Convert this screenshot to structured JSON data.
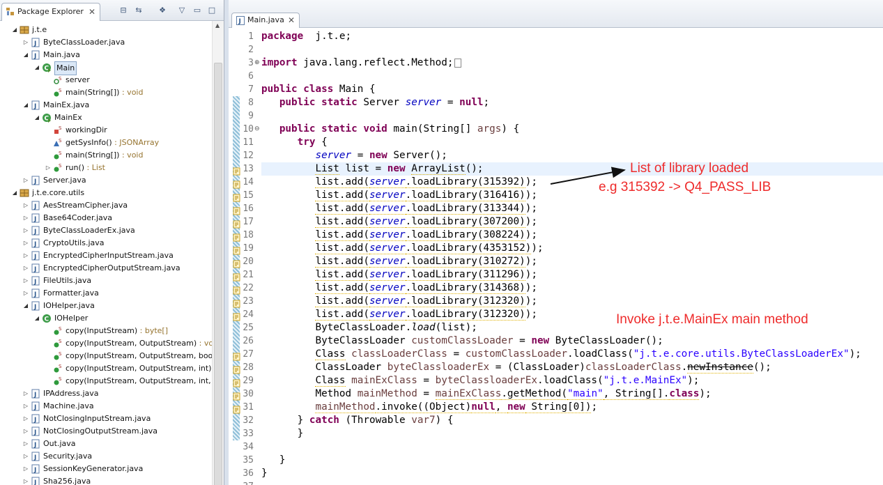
{
  "explorer": {
    "tab_label": "Package Explorer",
    "tree": [
      {
        "label": "j.t.e",
        "kind": "package",
        "level": 0,
        "twisty": "open"
      },
      {
        "label": "ByteClassLoader.java",
        "kind": "java",
        "level": 1,
        "twisty": "closed"
      },
      {
        "label": "Main.java",
        "kind": "java",
        "level": 1,
        "twisty": "open"
      },
      {
        "label": "Main",
        "kind": "class-main",
        "level": 2,
        "twisty": "open",
        "selected": true
      },
      {
        "label": "server",
        "kind": "field",
        "level": 3,
        "twisty": ""
      },
      {
        "label": "main(String[])",
        "suffix": " : void",
        "kind": "method",
        "level": 3,
        "twisty": ""
      },
      {
        "label": "MainEx.java",
        "kind": "java",
        "level": 1,
        "twisty": "open"
      },
      {
        "label": "MainEx",
        "kind": "class-main",
        "level": 2,
        "twisty": "open"
      },
      {
        "label": "workingDir",
        "kind": "field-private",
        "level": 3,
        "twisty": ""
      },
      {
        "label": "getSysInfo()",
        "suffix": " : JSONArray",
        "kind": "method-triangle",
        "level": 3,
        "twisty": ""
      },
      {
        "label": "main(String[])",
        "suffix": " : void",
        "kind": "method",
        "level": 3,
        "twisty": ""
      },
      {
        "label": "run()",
        "suffix": " : List",
        "kind": "method",
        "level": 3,
        "twisty": "closed"
      },
      {
        "label": "Server.java",
        "kind": "java",
        "level": 1,
        "twisty": "closed"
      },
      {
        "label": "j.t.e.core.utils",
        "kind": "package",
        "level": 0,
        "twisty": "open"
      },
      {
        "label": "AesStreamCipher.java",
        "kind": "java",
        "level": 1,
        "twisty": "closed"
      },
      {
        "label": "Base64Coder.java",
        "kind": "java",
        "level": 1,
        "twisty": "closed"
      },
      {
        "label": "ByteClassLoaderEx.java",
        "kind": "java",
        "level": 1,
        "twisty": "closed"
      },
      {
        "label": "CryptoUtils.java",
        "kind": "java",
        "level": 1,
        "twisty": "closed"
      },
      {
        "label": "EncryptedCipherInputStream.java",
        "kind": "java",
        "level": 1,
        "twisty": "closed"
      },
      {
        "label": "EncryptedCipherOutputStream.java",
        "kind": "java",
        "level": 1,
        "twisty": "closed"
      },
      {
        "label": "FileUtils.java",
        "kind": "java",
        "level": 1,
        "twisty": "closed"
      },
      {
        "label": "Formatter.java",
        "kind": "java",
        "level": 1,
        "twisty": "closed"
      },
      {
        "label": "IOHelper.java",
        "kind": "java",
        "level": 1,
        "twisty": "open"
      },
      {
        "label": "IOHelper",
        "kind": "class",
        "level": 2,
        "twisty": "open"
      },
      {
        "label": "copy(InputStream)",
        "suffix": " : byte[]",
        "kind": "method",
        "level": 3,
        "twisty": ""
      },
      {
        "label": "copy(InputStream, OutputStream)",
        "suffix": " : void",
        "kind": "method",
        "level": 3,
        "twisty": ""
      },
      {
        "label": "copy(InputStream, OutputStream, boole",
        "suffix": "",
        "kind": "method",
        "level": 3,
        "twisty": ""
      },
      {
        "label": "copy(InputStream, OutputStream, int)",
        "suffix": " :",
        "kind": "method",
        "level": 3,
        "twisty": ""
      },
      {
        "label": "copy(InputStream, OutputStream, int, b",
        "suffix": "",
        "kind": "method",
        "level": 3,
        "twisty": ""
      },
      {
        "label": "IPAddress.java",
        "kind": "java",
        "level": 1,
        "twisty": "closed"
      },
      {
        "label": "Machine.java",
        "kind": "java",
        "level": 1,
        "twisty": "closed"
      },
      {
        "label": "NotClosingInputStream.java",
        "kind": "java",
        "level": 1,
        "twisty": "closed"
      },
      {
        "label": "NotClosingOutputStream.java",
        "kind": "java",
        "level": 1,
        "twisty": "closed"
      },
      {
        "label": "Out.java",
        "kind": "java",
        "level": 1,
        "twisty": "closed"
      },
      {
        "label": "Security.java",
        "kind": "java",
        "level": 1,
        "twisty": "closed"
      },
      {
        "label": "SessionKeyGenerator.java",
        "kind": "java",
        "level": 1,
        "twisty": "closed"
      },
      {
        "label": "Sha256.java",
        "kind": "java",
        "level": 1,
        "twisty": "closed"
      }
    ]
  },
  "editor": {
    "tab_label": "Main.java",
    "lines": [
      {
        "n": "1",
        "segs": [
          [
            "kw",
            "package"
          ],
          [
            "",
            "  j.t.e;"
          ]
        ]
      },
      {
        "n": "2",
        "segs": []
      },
      {
        "n": "3",
        "fold": "+",
        "segs": [
          [
            "kw",
            "import"
          ],
          [
            "",
            " java.lang.reflect.Method;"
          ],
          [
            "foldbox",
            ""
          ]
        ]
      },
      {
        "n": "6",
        "segs": []
      },
      {
        "n": "7",
        "segs": [
          [
            "kw",
            "public"
          ],
          [
            "",
            " "
          ],
          [
            "kw",
            "class"
          ],
          [
            "",
            " Main {"
          ]
        ]
      },
      {
        "n": "8",
        "segs": [
          [
            "",
            "   "
          ],
          [
            "kw",
            "public"
          ],
          [
            "",
            " "
          ],
          [
            "kw",
            "static"
          ],
          [
            "",
            " Server "
          ],
          [
            "fld",
            "server"
          ],
          [
            "",
            " = "
          ],
          [
            "kw",
            "null"
          ],
          [
            ";"
          ]
        ]
      },
      {
        "n": "9",
        "segs": []
      },
      {
        "n": "10",
        "fold": "−",
        "segs": [
          [
            "",
            "   "
          ],
          [
            "kw",
            "public"
          ],
          [
            "",
            " "
          ],
          [
            "kw",
            "static"
          ],
          [
            "",
            " "
          ],
          [
            "kw",
            "void"
          ],
          [
            "",
            " main(String[] "
          ],
          [
            "gray",
            "args"
          ],
          [
            ") {"
          ]
        ]
      },
      {
        "n": "11",
        "segs": [
          [
            "",
            "      "
          ],
          [
            "kw",
            "try"
          ],
          [
            "",
            " {"
          ]
        ]
      },
      {
        "n": "12",
        "segs": [
          [
            "",
            "         "
          ],
          [
            "fld",
            "server"
          ],
          [
            "",
            " = "
          ],
          [
            "kw",
            "new"
          ],
          [
            "",
            " Server();"
          ]
        ]
      },
      {
        "n": "13",
        "warn": true,
        "current": true,
        "segs": [
          [
            "",
            "         "
          ],
          [
            "sq",
            "List"
          ],
          [
            "",
            " list = "
          ],
          [
            "kw",
            "new"
          ],
          [
            "",
            " "
          ],
          [
            "sq",
            "ArrayList"
          ],
          [
            "();"
          ]
        ]
      },
      {
        "n": "14",
        "warn": true,
        "segs": [
          [
            "",
            "         "
          ],
          [
            "sq",
            "list.add("
          ],
          [
            "fld sq",
            "server"
          ],
          [
            "sq",
            ".loadLibrary(315392)"
          ],
          [
            ");"
          ]
        ]
      },
      {
        "n": "15",
        "warn": true,
        "segs": [
          [
            "",
            "         "
          ],
          [
            "sq",
            "list.add("
          ],
          [
            "fld sq",
            "server"
          ],
          [
            "sq",
            ".loadLibrary(316416)"
          ],
          [
            ");"
          ]
        ]
      },
      {
        "n": "16",
        "warn": true,
        "segs": [
          [
            "",
            "         "
          ],
          [
            "sq",
            "list.add("
          ],
          [
            "fld sq",
            "server"
          ],
          [
            "sq",
            ".loadLibrary(313344)"
          ],
          [
            ");"
          ]
        ]
      },
      {
        "n": "17",
        "warn": true,
        "segs": [
          [
            "",
            "         "
          ],
          [
            "sq",
            "list.add("
          ],
          [
            "fld sq",
            "server"
          ],
          [
            "sq",
            ".loadLibrary(307200)"
          ],
          [
            ");"
          ]
        ]
      },
      {
        "n": "18",
        "warn": true,
        "segs": [
          [
            "",
            "         "
          ],
          [
            "sq",
            "list.add("
          ],
          [
            "fld sq",
            "server"
          ],
          [
            "sq",
            ".loadLibrary(308224)"
          ],
          [
            ");"
          ]
        ]
      },
      {
        "n": "19",
        "warn": true,
        "segs": [
          [
            "",
            "         "
          ],
          [
            "sq",
            "list.add("
          ],
          [
            "fld sq",
            "server"
          ],
          [
            "sq",
            ".loadLibrary(4353152)"
          ],
          [
            ");"
          ]
        ]
      },
      {
        "n": "20",
        "warn": true,
        "segs": [
          [
            "",
            "         "
          ],
          [
            "sq",
            "list.add("
          ],
          [
            "fld sq",
            "server"
          ],
          [
            "sq",
            ".loadLibrary(310272)"
          ],
          [
            ");"
          ]
        ]
      },
      {
        "n": "21",
        "warn": true,
        "segs": [
          [
            "",
            "         "
          ],
          [
            "sq",
            "list.add("
          ],
          [
            "fld sq",
            "server"
          ],
          [
            "sq",
            ".loadLibrary(311296)"
          ],
          [
            ");"
          ]
        ]
      },
      {
        "n": "22",
        "warn": true,
        "segs": [
          [
            "",
            "         "
          ],
          [
            "sq",
            "list.add("
          ],
          [
            "fld sq",
            "server"
          ],
          [
            "sq",
            ".loadLibrary(314368)"
          ],
          [
            ");"
          ]
        ]
      },
      {
        "n": "23",
        "warn": true,
        "segs": [
          [
            "",
            "         "
          ],
          [
            "sq",
            "list.add("
          ],
          [
            "fld sq",
            "server"
          ],
          [
            "sq",
            ".loadLibrary(312320)"
          ],
          [
            ");"
          ]
        ]
      },
      {
        "n": "24",
        "warn": true,
        "segs": [
          [
            "",
            "         "
          ],
          [
            "sq",
            "list.add("
          ],
          [
            "fld sq",
            "server"
          ],
          [
            "sq",
            ".loadLibrary(312320)"
          ],
          [
            ");"
          ]
        ]
      },
      {
        "n": "25",
        "segs": [
          [
            "",
            "         ByteClassLoader."
          ],
          [
            "ital",
            "load"
          ],
          [
            "",
            "(list);"
          ]
        ]
      },
      {
        "n": "26",
        "segs": [
          [
            "",
            "         ByteClassLoader "
          ],
          [
            "gray",
            "customClassLoader"
          ],
          [
            "",
            " = "
          ],
          [
            "kw",
            "new"
          ],
          [
            "",
            " ByteClassLoader();"
          ]
        ]
      },
      {
        "n": "27",
        "warn": true,
        "segs": [
          [
            "",
            "         "
          ],
          [
            "sq",
            "Class"
          ],
          [
            "",
            " "
          ],
          [
            "gray",
            "classLoaderClass"
          ],
          [
            "",
            " = "
          ],
          [
            "gray",
            "customClassLoader"
          ],
          [
            ".loadClass("
          ],
          [
            "str",
            "\"j.t.e.core.utils.ByteClassLoaderEx\""
          ],
          [
            ");"
          ]
        ]
      },
      {
        "n": "28",
        "warn": true,
        "segs": [
          [
            "",
            "         ClassLoader "
          ],
          [
            "gray",
            "byteClassloaderEx"
          ],
          [
            "",
            " = (ClassLoader)"
          ],
          [
            "gray",
            "classLoaderClass"
          ],
          [
            "",
            "."
          ],
          [
            "strike sq",
            "newInstance"
          ],
          [
            "",
            "();"
          ]
        ]
      },
      {
        "n": "29",
        "warn": true,
        "segs": [
          [
            "",
            "         "
          ],
          [
            "sq",
            "Class"
          ],
          [
            "",
            " "
          ],
          [
            "gray",
            "mainExClass"
          ],
          [
            "",
            " = "
          ],
          [
            "gray",
            "byteClassloaderEx"
          ],
          [
            ".loadClass("
          ],
          [
            "str",
            "\"j.t.e.MainEx\""
          ],
          [
            ");"
          ]
        ]
      },
      {
        "n": "30",
        "warn": true,
        "segs": [
          [
            "",
            "         Method "
          ],
          [
            "gray",
            "mainMethod"
          ],
          [
            "",
            " = "
          ],
          [
            "sq gray",
            "mainExClass"
          ],
          [
            "sq",
            ".getMethod("
          ],
          [
            "str sq",
            "\"main\""
          ],
          [
            "sq",
            ", String[]."
          ],
          [
            "kw sq",
            "class"
          ],
          [
            ");"
          ]
        ]
      },
      {
        "n": "31",
        "warn": true,
        "segs": [
          [
            "",
            "         "
          ],
          [
            "gray sq",
            "mainMethod"
          ],
          [
            "sq",
            ".invoke((Object)"
          ],
          [
            "kw sq",
            "null"
          ],
          [
            "sq",
            ", "
          ],
          [
            "kw sq",
            "new"
          ],
          [
            "sq",
            " String[0])"
          ],
          [
            ";"
          ]
        ]
      },
      {
        "n": "32",
        "segs": [
          [
            "",
            "      } "
          ],
          [
            "kw",
            "catch"
          ],
          [
            "",
            " (Throwable "
          ],
          [
            "gray",
            "var7"
          ],
          [
            ") {"
          ]
        ]
      },
      {
        "n": "33",
        "segs": [
          [
            "",
            "      }"
          ]
        ]
      },
      {
        "n": "34",
        "segs": []
      },
      {
        "n": "35",
        "segs": [
          [
            "",
            "   }"
          ]
        ]
      },
      {
        "n": "36",
        "segs": [
          [
            "",
            "}"
          ]
        ]
      },
      {
        "n": "37",
        "segs": []
      }
    ]
  },
  "annotations": {
    "library_note_line1": "List of library loaded",
    "library_note_line2": "e.g 315392 -> Q4_PASS_LIB",
    "invoke_note": "Invoke j.t.e.MainEx main method"
  },
  "colors": {
    "keyword": "#7f0055",
    "field": "#0000c0",
    "string": "#2a00ff",
    "annotation": "#ee2b2b",
    "current_line": "#e8f2fe"
  }
}
